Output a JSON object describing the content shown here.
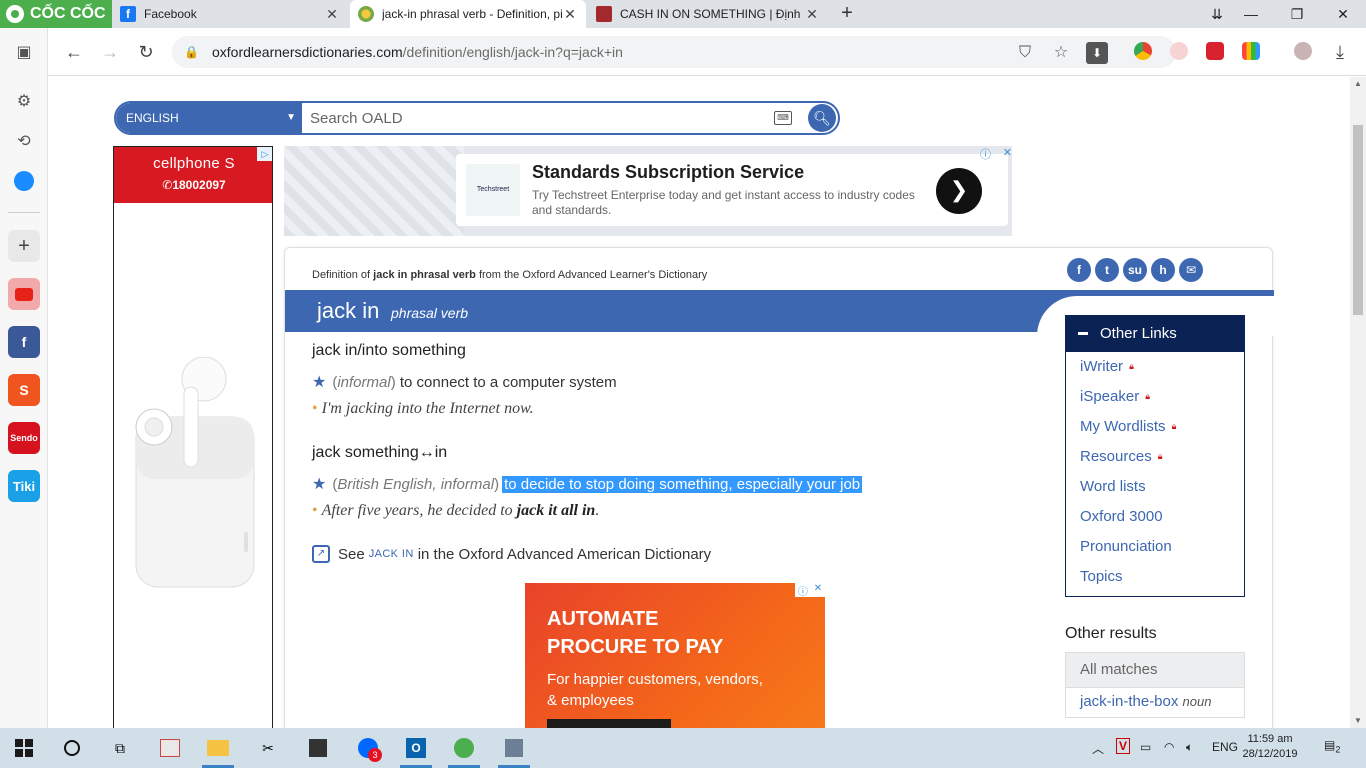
{
  "browser": {
    "brand": "CỐC CỐC",
    "tabs": [
      {
        "title": "Facebook",
        "active": false
      },
      {
        "title": "jack-in phrasal verb - Definition, pi",
        "active": true
      },
      {
        "title": "CASH IN ON SOMETHING | Định n",
        "active": false
      }
    ],
    "url_host": "oxfordlearnersdictionaries.com",
    "url_path": "/definition/english/jack-in?q=jack+in"
  },
  "search": {
    "language": "ENGLISH",
    "placeholder": "Search OALD"
  },
  "ads": {
    "left_brand": "cellphone S",
    "left_phone": "✆18002097",
    "top_logo": "Techstreet",
    "top_title": "Standards Subscription Service",
    "top_desc": "Try Techstreet Enterprise today and get instant access to industry codes and standards.",
    "bottom_headline_1": "AUTOMATE",
    "bottom_headline_2": "PROCURE TO PAY",
    "bottom_sub_1": "For happier customers, vendors,",
    "bottom_sub_2": "& employees"
  },
  "entry": {
    "defof_prefix": "Definition of",
    "defof_word": "jack in phrasal verb",
    "defof_suffix": "from the Oxford Advanced Learner's Dictionary",
    "headword": "jack in",
    "pos": "phrasal verb",
    "senses": [
      {
        "head": "jack in/into something",
        "label": "informal",
        "definition": "to connect to a computer system",
        "example": "I'm jacking into the Internet now."
      },
      {
        "head": "jack something↔in",
        "label": "British English, informal",
        "definition": "to decide to stop doing something, especially your job",
        "example_pre": "After five years, he decided to",
        "example_bold": "jack it all in",
        "example_post": "."
      }
    ],
    "see_pre": "See",
    "see_link": "JACK IN",
    "see_post": "in the Oxford Advanced American Dictionary"
  },
  "other_links": {
    "title": "Other Links",
    "items": [
      {
        "label": "iWriter",
        "locked": true
      },
      {
        "label": "iSpeaker",
        "locked": true
      },
      {
        "label": "My Wordlists",
        "locked": true
      },
      {
        "label": "Resources",
        "locked": true
      },
      {
        "label": "Word lists",
        "locked": false
      },
      {
        "label": "Oxford 3000",
        "locked": false
      },
      {
        "label": "Pronunciation",
        "locked": false
      },
      {
        "label": "Topics",
        "locked": false
      }
    ]
  },
  "other_results": {
    "title": "Other results",
    "all_matches": "All matches",
    "first_match_word": "jack-in-the-box",
    "first_match_pos": "noun"
  },
  "taskbar": {
    "lang": "ENG",
    "time": "11:59 am",
    "date": "28/12/2019",
    "notif_count": "2",
    "zalo_badge": "3"
  },
  "colors": {
    "oxford_blue": "#3d67b1",
    "navy": "#0b2254",
    "coccoc_green": "#4cae4c",
    "selection": "#3399ff"
  }
}
